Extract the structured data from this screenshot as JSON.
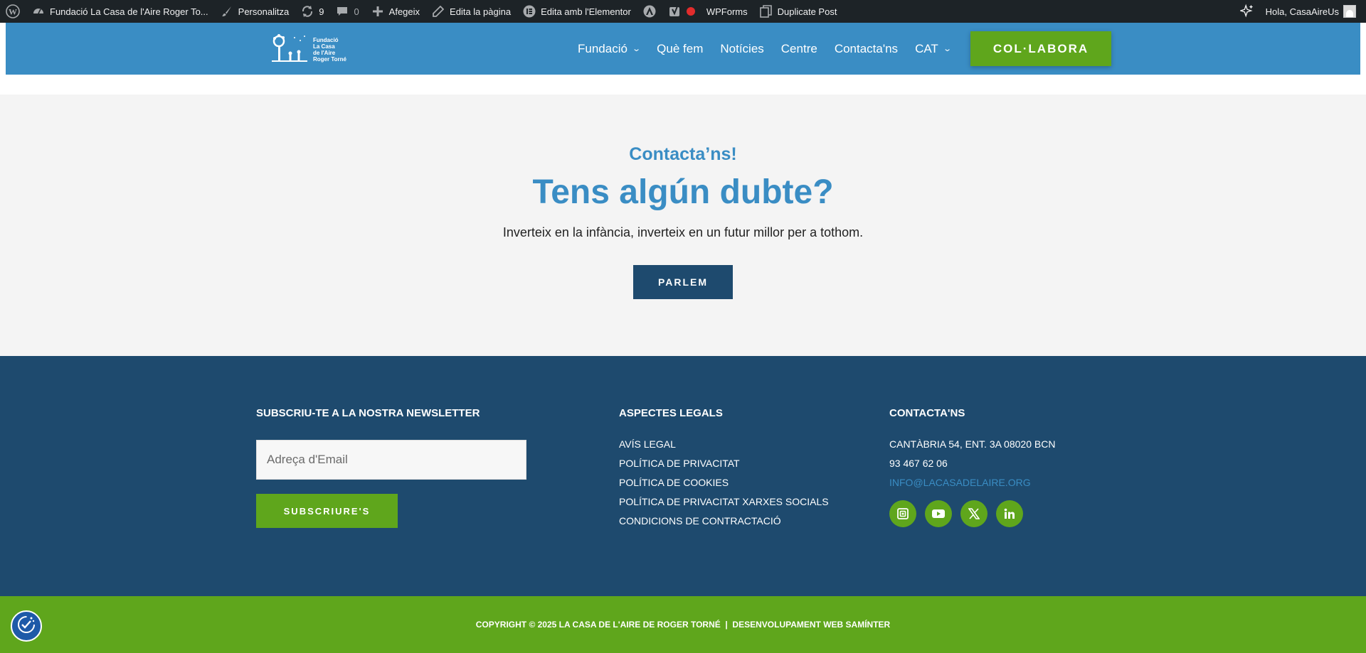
{
  "adminbar": {
    "site_name": "Fundació La Casa de l'Aire Roger To...",
    "customize": "Personalitza",
    "updates_count": "9",
    "comments_count": "0",
    "add_new": "Afegeix",
    "edit_page": "Edita la pàgina",
    "edit_elementor": "Edita amb l'Elementor",
    "wpforms": "WPForms",
    "duplicate_post": "Duplicate Post",
    "greeting": "Hola, CasaAireUs"
  },
  "header": {
    "logo_text": [
      "Fundació",
      "La Casa",
      "de l'Aire",
      "Roger Torné"
    ],
    "nav": [
      {
        "label": "Fundació",
        "dropdown": true
      },
      {
        "label": "Què fem",
        "dropdown": false
      },
      {
        "label": "Notícies",
        "dropdown": false
      },
      {
        "label": "Centre",
        "dropdown": false
      },
      {
        "label": "Contacta'ns",
        "dropdown": false
      },
      {
        "label": "CAT",
        "dropdown": true
      }
    ],
    "cta_label": "COL·LABORA",
    "bg_color": "#3a8dc4",
    "cta_color": "#5fa61c"
  },
  "contact": {
    "eyebrow": "Contacta’ns!",
    "headline": "Tens algún dubte?",
    "lead": "Inverteix en la infància, inverteix en un futur millor per a tothom.",
    "button_label": "PARLEM"
  },
  "footer": {
    "newsletter_heading": "SUBSCRIU-TE A LA NOSTRA NEWSLETTER",
    "email_placeholder": "Adreça d'Email",
    "subscribe_label": "SUBSCRIURE'S",
    "legal_heading": "ASPECTES LEGALS",
    "legal_links": [
      "AVÍS LEGAL",
      "POLÍTICA DE PRIVACITAT",
      "POLÍTICA DE COOKIES",
      "POLÍTICA DE PRIVACITAT XARXES SOCIALS",
      "CONDICIONS DE CONTRACTACIÓ"
    ],
    "contact_heading": "CONTACTA'NS",
    "address": "CANTÀBRIA 54, ENT. 3A 08020 BCN",
    "phone": "93 467 62 06",
    "email": "INFO@LACASADELAIRE.ORG",
    "socials": [
      "instagram-icon",
      "youtube-icon",
      "x-icon",
      "linkedin-icon"
    ],
    "bg_color": "#1e4a6e"
  },
  "bottom": {
    "copyright": "COPYRIGHT © 2025 LA CASA DE L'AIRE DE ROGER TORNÉ  |  DESENVOLUPAMENT WEB SAMÍNTER",
    "bg_color": "#5fa61c"
  }
}
